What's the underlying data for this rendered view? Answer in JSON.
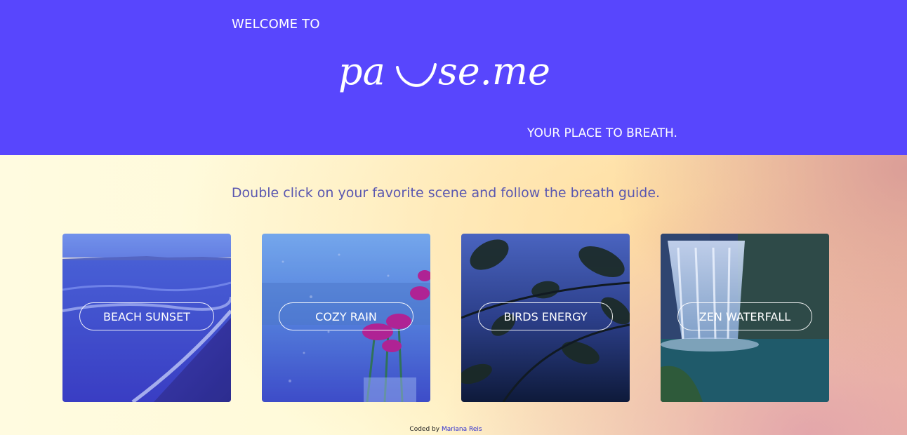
{
  "header": {
    "welcome": "WELCOME TO",
    "logo_text": "pause.me",
    "tagline": "YOUR PLACE TO BREATH.",
    "background_color": "#5846fd"
  },
  "instruction": "Double click on your favorite scene and follow the breath guide.",
  "scenes": [
    {
      "label": "BEACH SUNSET"
    },
    {
      "label": "COZY RAIN"
    },
    {
      "label": "BIRDS ENERGY"
    },
    {
      "label": "ZEN WATERFALL"
    }
  ],
  "footer": {
    "prefix": "Coded by",
    "author": "Mariana Reis"
  }
}
